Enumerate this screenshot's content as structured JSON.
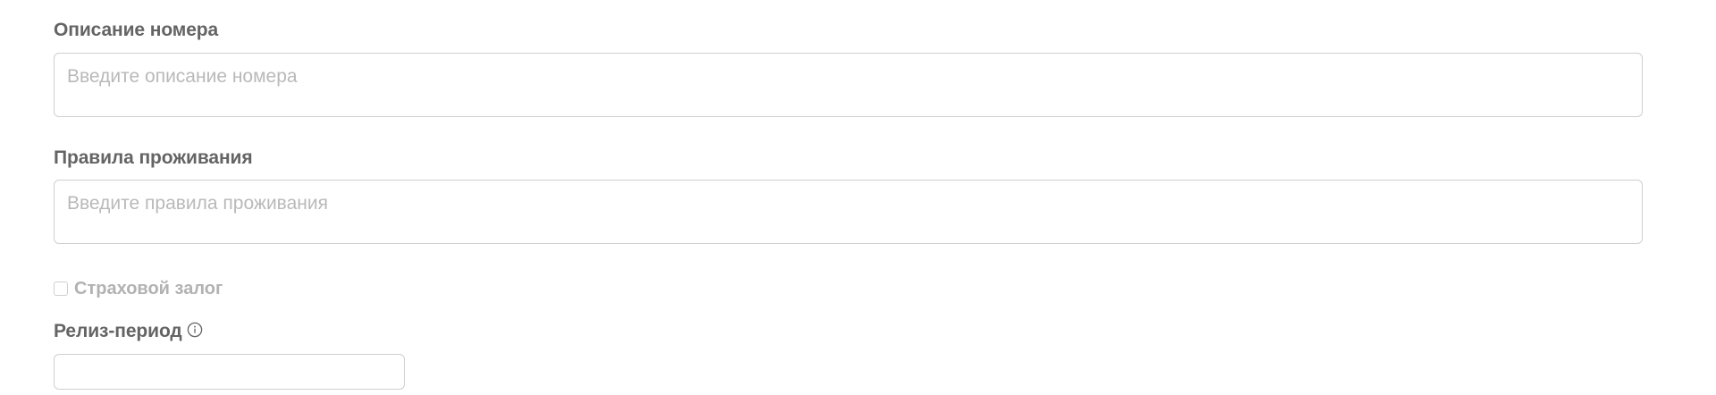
{
  "form": {
    "room_description": {
      "label": "Описание номера",
      "placeholder": "Введите описание номера",
      "value": ""
    },
    "house_rules": {
      "label": "Правила проживания",
      "placeholder": "Введите правила проживания",
      "value": ""
    },
    "insurance_deposit": {
      "label": "Страховой залог",
      "checked": false
    },
    "release_period": {
      "label": "Релиз-период",
      "value": "",
      "info_icon": "info-circle-icon"
    }
  },
  "colors": {
    "label": "#646464",
    "placeholder": "#b9b9b9",
    "border": "#cfcfcf",
    "disabled_text": "#b2b2b2"
  }
}
